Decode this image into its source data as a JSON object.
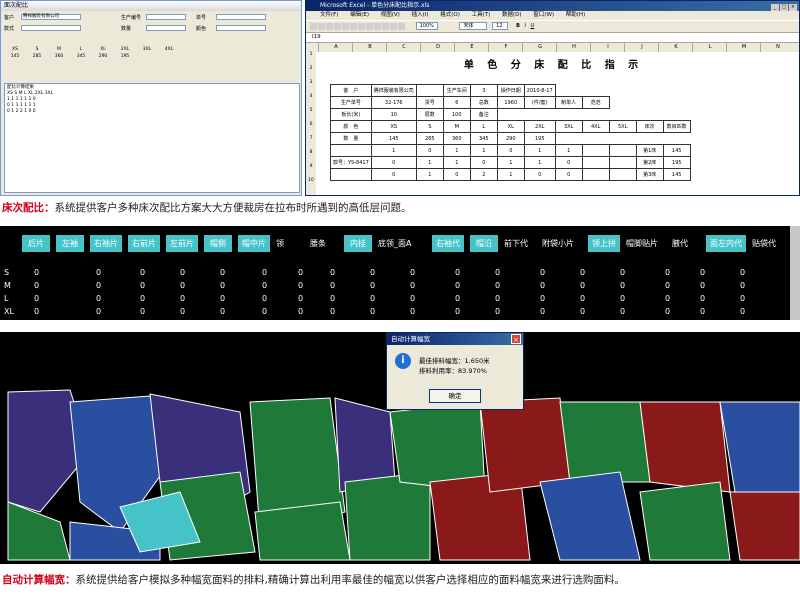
{
  "left_dialog": {
    "title": "面次配比",
    "fields": [
      {
        "label": "客户",
        "value": "腾祥服装有限公司"
      },
      {
        "label": "生产编号",
        "value": ""
      },
      {
        "label": "单号",
        "value": ""
      },
      {
        "label": "款式",
        "value": ""
      },
      {
        "label": "数量",
        "value": ""
      },
      {
        "label": "颜色",
        "value": ""
      }
    ],
    "size_headers": [
      "XS",
      "S",
      "M",
      "L",
      "XL",
      "2XL",
      "3XL",
      "4XL"
    ],
    "size_values": [
      "145",
      "285",
      "360",
      "345",
      "290",
      "195",
      "",
      ""
    ],
    "list_lines": [
      "配比计算结果",
      "XS  S  M  L  XL  2XL  3XL",
      "1   1  1  1  1   1    0",
      "0   1  1  1  1   1    1",
      "0   1  2  2  1   0    0"
    ]
  },
  "excel": {
    "title": "Microsoft Excel - 单色分床配比指示.xls",
    "menu": [
      "文件(F)",
      "编辑(E)",
      "视图(V)",
      "插入(I)",
      "格式(O)",
      "工具(T)",
      "数据(D)",
      "窗口(W)",
      "帮助(H)"
    ],
    "zoom": "100%",
    "font": "宋体",
    "font_size": "12",
    "cell_ref": "I19",
    "columns": [
      "A",
      "B",
      "C",
      "D",
      "E",
      "F",
      "G",
      "H",
      "I",
      "J",
      "K",
      "L",
      "M",
      "N"
    ],
    "sheet_title": "单 色 分 床 配 比 指 示",
    "rows": [
      [
        "客　户",
        "腾祥服装有限公司",
        "",
        "生产车间",
        "3",
        "操作日期",
        "2010-8-17"
      ],
      [
        "生产单号",
        "32-176",
        "货号",
        "6",
        "总数",
        "1960",
        "(件/套)",
        "制单人",
        "范范"
      ],
      [
        "板长(米)",
        "10",
        "层数",
        "100",
        "备注"
      ],
      [
        "颜　色",
        "XS",
        "S",
        "M",
        "L",
        "XL",
        "2XL",
        "3XL",
        "4XL",
        "5XL",
        "床次",
        "数目匹数"
      ],
      [
        "数　量",
        "145",
        "285",
        "360",
        "345",
        "290",
        "195"
      ],
      [
        "",
        "1",
        "0",
        "1",
        "1",
        "0",
        "1",
        "1",
        "",
        "",
        "第1床",
        "145"
      ],
      [
        "款号：YS-8417",
        "0",
        "1",
        "1",
        "0",
        "1",
        "1",
        "0",
        "",
        "",
        "第2床",
        "195"
      ],
      [
        "",
        "0",
        "1",
        "0",
        "2",
        "1",
        "0",
        "0",
        "",
        "",
        "第3床",
        "145"
      ]
    ]
  },
  "caption1": {
    "keyword": "床次配比：",
    "text": "系统提供客户多种床次配比方案大大方便裁房在拉布时所遇到的高低层问题。"
  },
  "strip": {
    "pieces": [
      "后片",
      "左袖",
      "右袖片",
      "右前片",
      "左前片",
      "帽侧",
      "帽中片",
      "领",
      "腰条",
      "内挂",
      "底领_面A",
      "右袖代",
      "帽沿",
      "前下代",
      "附袋小片",
      "领上拼",
      "帽脚贴片",
      "腋代",
      "面左内代",
      "贴袋代"
    ],
    "row_labels": [
      "S",
      "M",
      "L",
      "XL"
    ],
    "zero": "0"
  },
  "calc_dialog": {
    "title": "自动计算幅宽",
    "line1": "最佳排料幅宽：1.650米",
    "line2": "排料利用率：83.970%",
    "ok_label": "确定"
  },
  "caption2": {
    "keyword": "自动计算幅宽：",
    "text": "系统提供给客户模拟多种幅宽面料的排料,精确计算出利用率最佳的幅宽以供客户选择相应的面料幅宽来进行选购面料。"
  },
  "colors": {
    "accent_red": "#d6001c",
    "piece_teal": "#46c3c8",
    "marker_green": "#1f7a3a",
    "marker_purple": "#3a2f7a",
    "marker_red": "#8a1a1a",
    "marker_blue": "#2a4fa0"
  }
}
